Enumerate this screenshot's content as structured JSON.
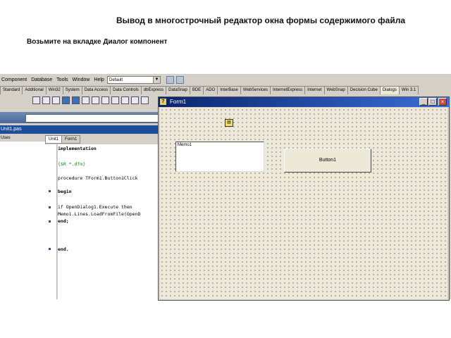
{
  "slide": {
    "title": "Вывод в многострочный редактор окна формы содержимого файла",
    "subtitle": "Возьмите на вкладке Диалог компонент"
  },
  "ide": {
    "menu": [
      "Component",
      "Database",
      "Tools",
      "Window",
      "Help"
    ],
    "layout_combo": "Default",
    "palette_tabs": [
      "Standard",
      "Additional",
      "Win32",
      "System",
      "Data Access",
      "Data Controls",
      "dbExpress",
      "DataSnap",
      "BDE",
      "ADO",
      "InterBase",
      "WebServices",
      "InternetExpress",
      "Internet",
      "WebSnap",
      "Decision Cube",
      "Dialogs",
      "Win 3.1"
    ],
    "selected_tab": "Dialogs",
    "file_title": "Unit1.pas",
    "explorer_header": "Uses",
    "editor_tabs": [
      "Unit1",
      "Form1"
    ],
    "code_lines": [
      "implementation",
      "{$R *.dfm}",
      "procedure TForm1.Button1Click",
      "begin",
      "  if OpenDialog1.Execute then",
      "  Memo1.Lines.LoadFromFile(OpenD",
      "end;",
      "end."
    ]
  },
  "form": {
    "caption": "Form1",
    "memo_text": "Memo1",
    "button_label": "Button1",
    "caption_buttons": [
      "_",
      "□",
      "×"
    ]
  }
}
